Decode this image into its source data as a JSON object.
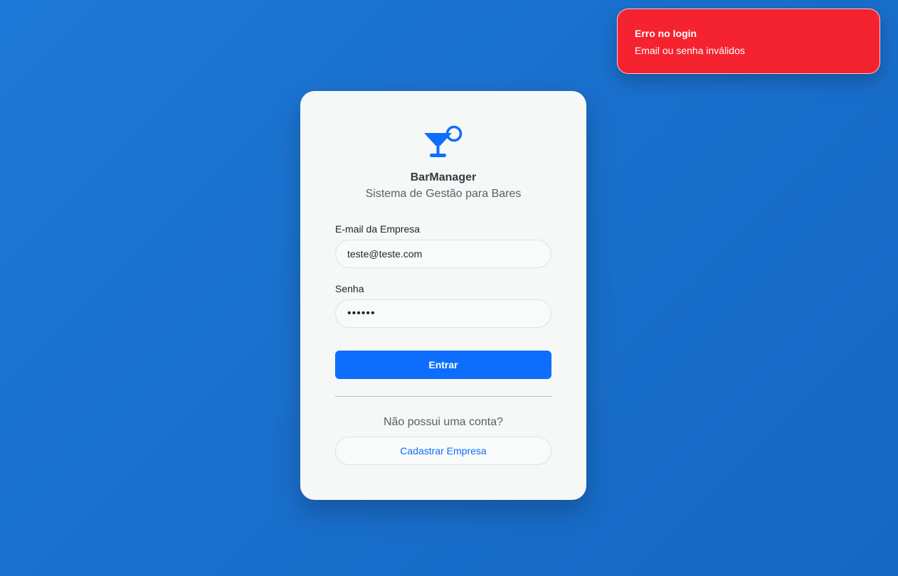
{
  "toast": {
    "title": "Erro no login",
    "message": "Email ou senha inválidos",
    "color": "#f5222f"
  },
  "brand": {
    "icon": "cocktail-icon",
    "name": "BarManager",
    "tagline": "Sistema de Gestão para Bares"
  },
  "form": {
    "email_label": "E-mail da Empresa",
    "email_value": "teste@teste.com",
    "password_label": "Senha",
    "password_value": "••••••",
    "submit_label": "Entrar"
  },
  "signup": {
    "prompt": "Não possui uma conta?",
    "button_label": "Cadastrar Empresa"
  },
  "colors": {
    "primary": "#0d6efd",
    "background": "#1a6fcc",
    "card": "#f6f7f7"
  }
}
